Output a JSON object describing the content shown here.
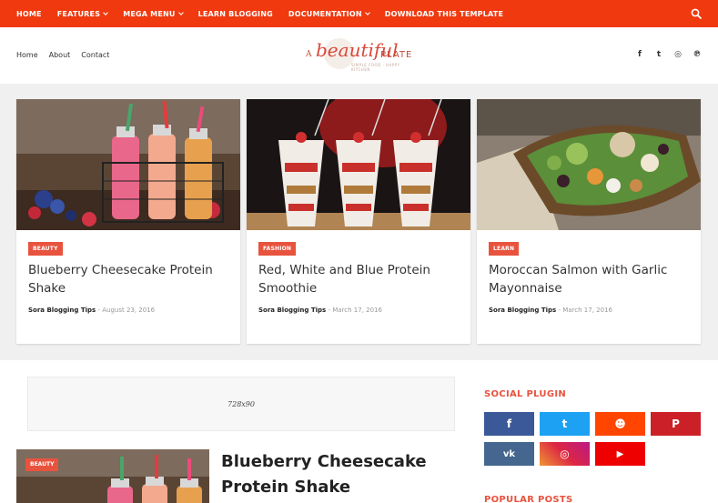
{
  "topnav": {
    "items": [
      {
        "label": "HOME",
        "has_dropdown": false
      },
      {
        "label": "FEATURES",
        "has_dropdown": true
      },
      {
        "label": "MEGA MENU",
        "has_dropdown": true
      },
      {
        "label": "LEARN BLOGGING",
        "has_dropdown": false
      },
      {
        "label": "DOCUMENTATION",
        "has_dropdown": true
      },
      {
        "label": "DOWNLOAD THIS TEMPLATE",
        "has_dropdown": false
      }
    ],
    "search_icon": "search-icon",
    "bg_color": "#f0390f"
  },
  "header": {
    "pages": [
      "Home",
      "About",
      "Contact"
    ],
    "logo": {
      "prefix": "A",
      "script": "beautiful",
      "suffix": "PLATE",
      "tagline": "SIMPLE FOOD · HAPPY KITCHEN"
    },
    "social": [
      {
        "icon": "facebook-icon",
        "glyph": "f"
      },
      {
        "icon": "twitter-icon",
        "glyph": "t"
      },
      {
        "icon": "instagram-icon",
        "glyph": "◎"
      },
      {
        "icon": "pinterest-icon",
        "glyph": "℗"
      }
    ]
  },
  "featured": [
    {
      "badge": "BEAUTY",
      "title": "Blueberry Cheesecake Protein Shake",
      "author": "Sora Blogging Tips",
      "sep": "-",
      "date": "August 23, 2016"
    },
    {
      "badge": "FASHION",
      "title": "Red, White and Blue Protein Smoothie",
      "author": "Sora Blogging Tips",
      "sep": "-",
      "date": "March 17, 2016"
    },
    {
      "badge": "LEARN",
      "title": "Moroccan Salmon with Garlic Mayonnaise",
      "author": "Sora Blogging Tips",
      "sep": "-",
      "date": "March 17, 2016"
    }
  ],
  "ad": {
    "label": "728x90"
  },
  "main_post": {
    "badge": "BEAUTY",
    "title": "Blueberry Cheesecake Protein Shake"
  },
  "sidebar": {
    "social_heading": "SOCIAL PLUGIN",
    "social_buttons": [
      {
        "icon": "facebook-icon",
        "glyph": "f",
        "color": "#3b5998"
      },
      {
        "icon": "twitter-icon",
        "glyph": "t",
        "color": "#1da1f2"
      },
      {
        "icon": "reddit-icon",
        "glyph": "☻",
        "color": "#ff4500"
      },
      {
        "icon": "pinterest-icon",
        "glyph": "P",
        "color": "#cb2027"
      },
      {
        "icon": "vk-icon",
        "glyph": "vk",
        "color": "#45668e"
      },
      {
        "icon": "instagram-icon",
        "glyph": "◎",
        "color": "#c13584"
      },
      {
        "icon": "youtube-icon",
        "glyph": "▶",
        "color": "#e00"
      }
    ],
    "popular_heading": "POPULAR POSTS"
  },
  "colors": {
    "accent": "#e8533e",
    "band": "#f0f0f0"
  }
}
